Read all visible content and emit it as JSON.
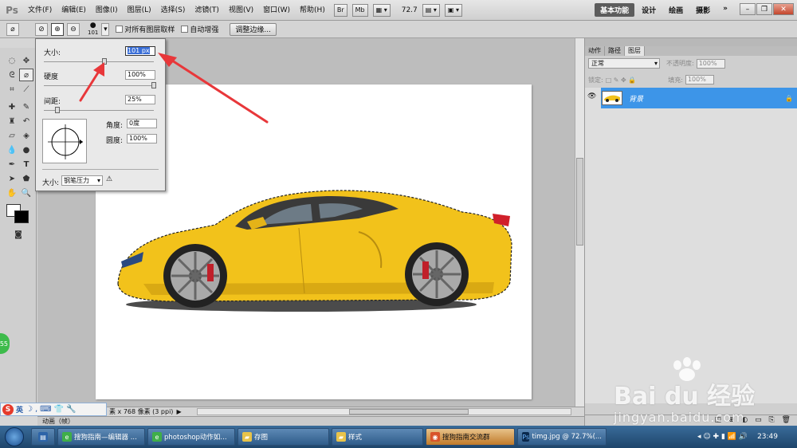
{
  "app": {
    "logo": "Ps"
  },
  "menu": [
    "文件(F)",
    "编辑(E)",
    "图像(I)",
    "图层(L)",
    "选择(S)",
    "滤镜(T)",
    "视图(V)",
    "窗口(W)",
    "帮助(H)"
  ],
  "menubar": {
    "btn_br": "Br",
    "btn_mb": "Mb",
    "zoom": "72.7"
  },
  "workspaces": [
    "基本功能",
    "设计",
    "绘画",
    "摄影"
  ],
  "workspaces_more": "»",
  "options": {
    "brush_size": "101",
    "sample_all_layers": "对所有图层取样",
    "auto_enhance": "自动增强",
    "refine_edge": "调整边缘..."
  },
  "brush_popup": {
    "size_label": "大小:",
    "size_value": "101 px",
    "size_level": 0.55,
    "hardness_label": "硬度",
    "hardness_value": "100%",
    "hardness_level": 1.0,
    "spacing_label": "间距:",
    "spacing_value": "25%",
    "spacing_level": 0.12,
    "angle_label": "角度:",
    "angle_value": "0度",
    "roundness_label": "圆度:",
    "roundness_value": "100%",
    "size_control_label": "大小:",
    "size_control_value": "钢笔压力"
  },
  "status": {
    "doc_info": "素 x 768 像素 (3 ppi)"
  },
  "animation": {
    "label": "动画（帧）"
  },
  "panels": {
    "tabs": [
      "动作",
      "路径",
      "图层"
    ],
    "blend_mode": "正常",
    "opacity_label": "不透明度:",
    "opacity": "100%",
    "lock_label": "锁定:",
    "fill_label": "填充:",
    "fill": "100%",
    "layer_name": "背景"
  },
  "taskbar": {
    "items": [
      "搜狗指南—编辑器 ...",
      "photoshop动作如...",
      "存图",
      "样式",
      "搜狗指南交流群",
      "timg.jpg @ 72.7%(..."
    ],
    "clock": "23:49"
  },
  "ime": {
    "label": "英"
  },
  "badge": "55",
  "watermark": {
    "main": "Bai du 经验",
    "url": "jingyan.baidu.com"
  },
  "colors": {
    "accent": "#3d95e8",
    "arrow": "#e8373a",
    "car": "#f2c21b"
  }
}
